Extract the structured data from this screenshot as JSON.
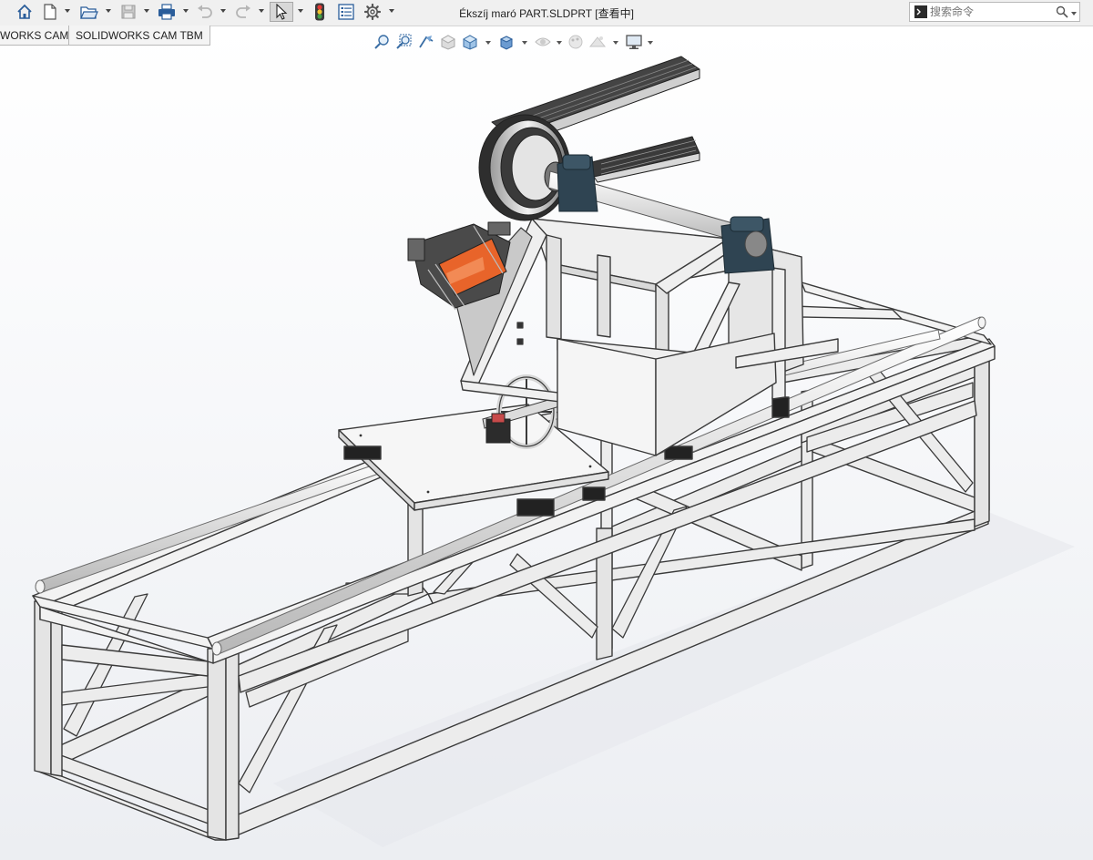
{
  "window": {
    "title": "Ékszíj maró PART.SLDPRT [查看中]"
  },
  "quick_access": {
    "items": [
      {
        "name": "home",
        "icon": "home-icon"
      },
      {
        "name": "new",
        "icon": "new-document-icon"
      },
      {
        "name": "open",
        "icon": "open-folder-icon"
      },
      {
        "name": "save",
        "icon": "save-icon"
      },
      {
        "name": "print",
        "icon": "print-icon"
      },
      {
        "name": "undo",
        "icon": "undo-icon"
      },
      {
        "name": "redo",
        "icon": "redo-icon"
      },
      {
        "name": "select",
        "icon": "select-arrow-icon"
      },
      {
        "name": "rebuild",
        "icon": "traffic-light-icon"
      },
      {
        "name": "file-properties",
        "icon": "file-properties-icon"
      },
      {
        "name": "options",
        "icon": "gear-icon"
      }
    ]
  },
  "search": {
    "placeholder": "搜索命令",
    "icon": "command-prompt-icon",
    "search_icon": "magnifier-icon"
  },
  "command_tabs": [
    {
      "label": "WORKS CAM"
    },
    {
      "label": "SOLIDWORKS CAM TBM"
    }
  ],
  "heads_up_toolbar": {
    "items": [
      {
        "name": "zoom-to-fit",
        "icon": "zoom-to-fit-icon"
      },
      {
        "name": "zoom-to-area",
        "icon": "zoom-to-area-icon"
      },
      {
        "name": "previous-view",
        "icon": "previous-view-icon"
      },
      {
        "name": "section-view",
        "icon": "section-view-icon"
      },
      {
        "name": "view-orientation",
        "icon": "view-orientation-icon"
      },
      {
        "name": "display-style",
        "icon": "display-style-icon"
      },
      {
        "name": "hide-show-items",
        "icon": "hide-show-icon"
      },
      {
        "name": "edit-appearance",
        "icon": "appearance-icon"
      },
      {
        "name": "apply-scene",
        "icon": "scene-icon"
      },
      {
        "name": "view-settings",
        "icon": "monitor-icon"
      }
    ]
  },
  "colors": {
    "frame_face": "#ececec",
    "frame_edge": "#3a3a3a",
    "motor_accent": "#e8642a",
    "bearing_block": "#2f4452",
    "select_active": "#d8d8d8"
  }
}
